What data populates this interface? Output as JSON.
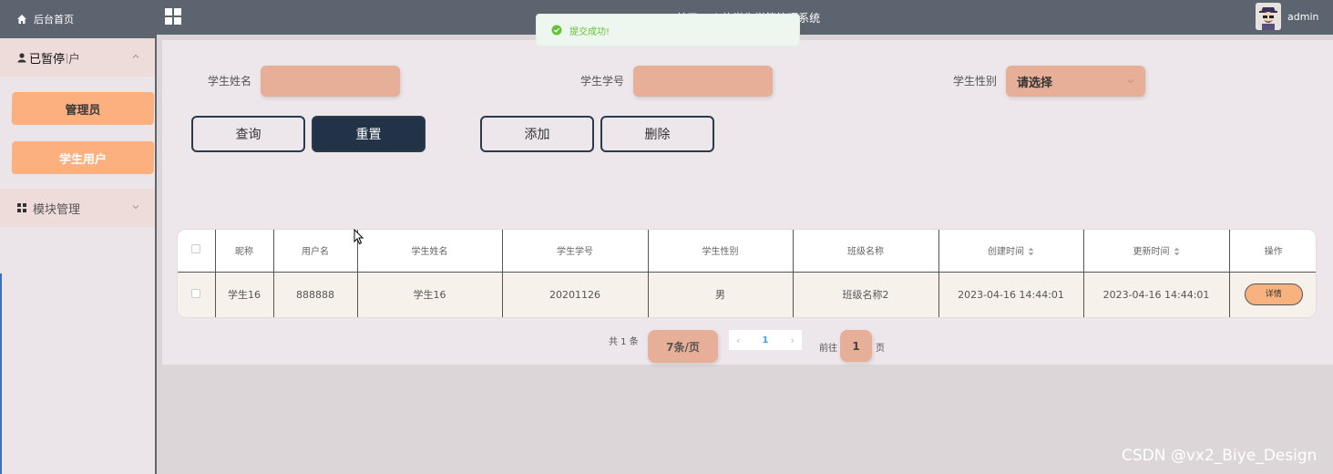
{
  "sidebar": {
    "home_label": "后台首页",
    "group1_label": "学生用户",
    "group1_overlap_label": "已暂停",
    "items": [
      {
        "label": "管理员"
      },
      {
        "label": "学生用户"
      }
    ],
    "group2_label": "模块管理"
  },
  "header": {
    "title": "基于Web的学生学籍管理系统",
    "user_name": "admin"
  },
  "toast": {
    "message": "提交成功!"
  },
  "search": {
    "name_label": "学生姓名",
    "name_value": "",
    "number_label": "学生学号",
    "number_value": "",
    "gender_label": "学生性别",
    "gender_value": "请选择"
  },
  "actions": {
    "query": "查询",
    "reset": "重置",
    "add": "添加",
    "delete": "删除"
  },
  "table": {
    "columns": [
      "昵称",
      "用户名",
      "学生姓名",
      "学生学号",
      "学生性别",
      "班级名称",
      "创建时间",
      "更新时间",
      "操作"
    ],
    "rows": [
      {
        "nickname": "学生16",
        "username": "888888",
        "student_name": "学生16",
        "student_no": "20201126",
        "gender": "男",
        "class_name": "班级名称2",
        "created": "2023-04-16 14:44:01",
        "updated": "2023-04-16 14:44:01",
        "action": "详情"
      }
    ]
  },
  "pagination": {
    "total": "共 1 条",
    "page_size": "7条/页",
    "current_page": "1",
    "goto_prefix": "前往",
    "goto_value": "1",
    "goto_suffix": "页"
  },
  "watermark": "CSDN @vx2_Biye_Design",
  "colors": {
    "topbar": "#5c6470",
    "accent_orange": "#fdb07f",
    "input_fill": "#e7ae98",
    "dark_button": "#223247",
    "toast_green": "#67c23a"
  }
}
